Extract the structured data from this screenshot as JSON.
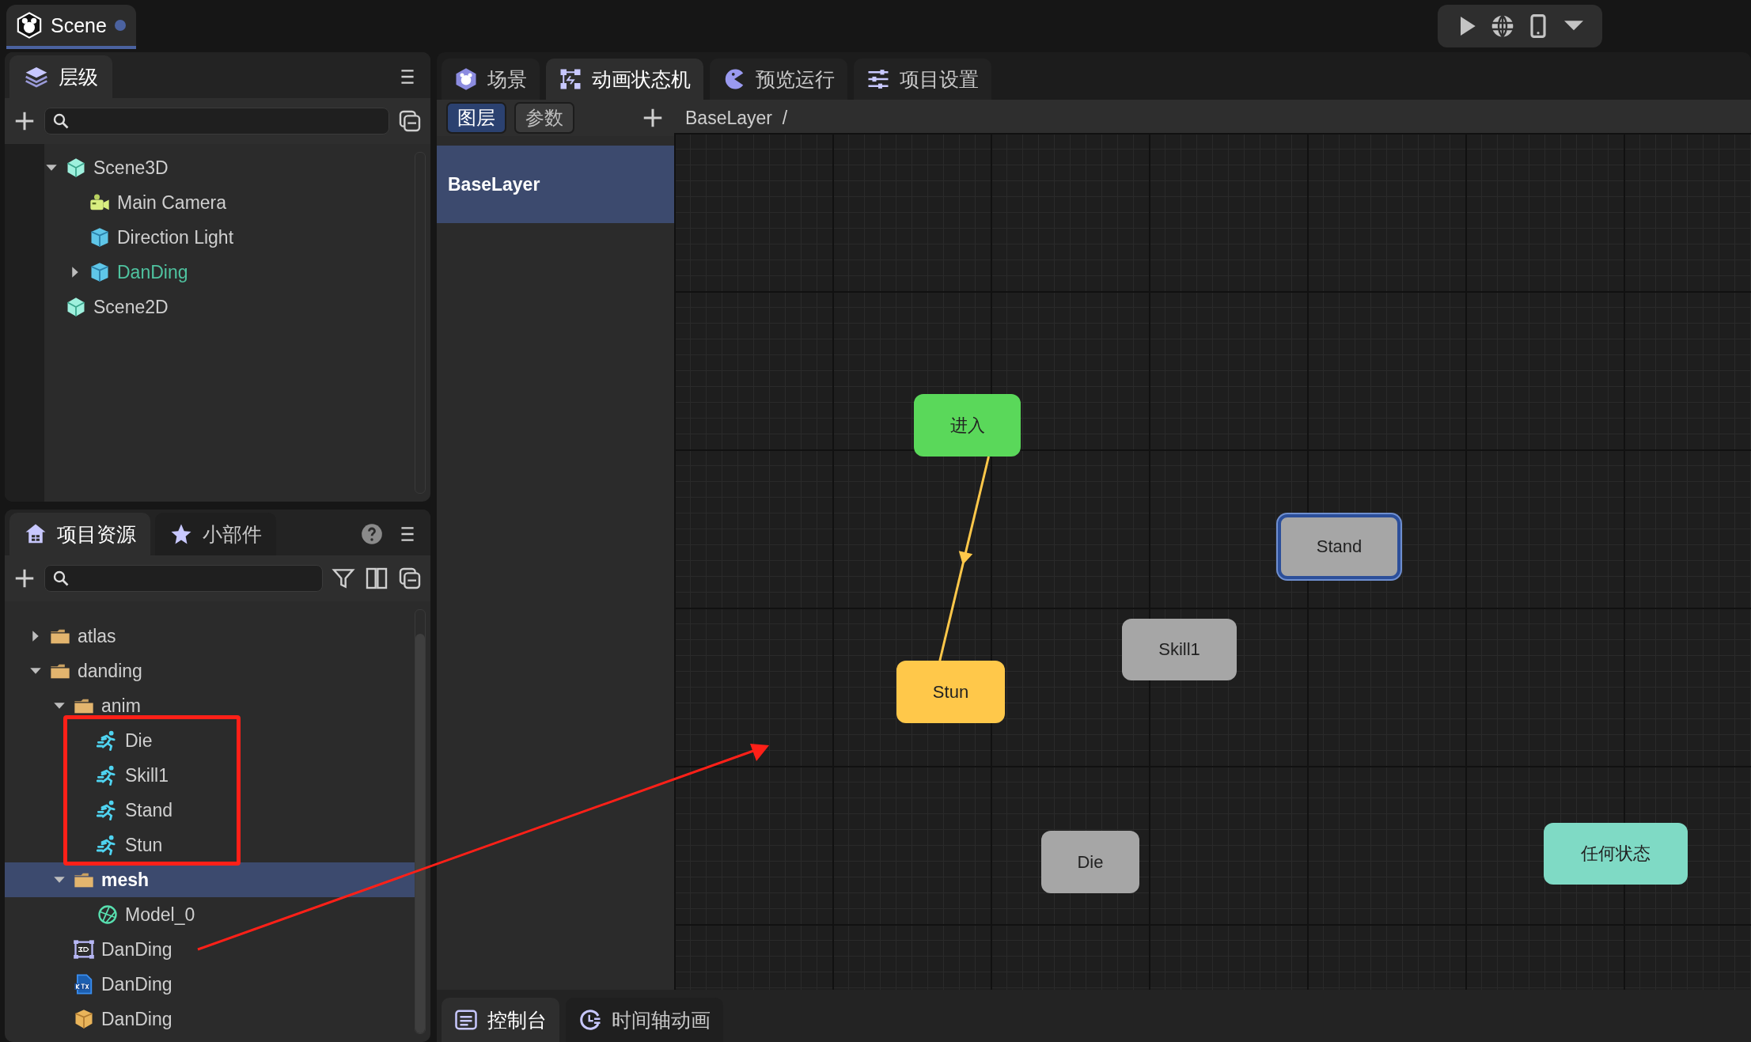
{
  "scene_tab": {
    "label": "Scene",
    "modified": true
  },
  "hierarchy": {
    "tab": "层级",
    "items": [
      {
        "label": "Scene3D",
        "kind": "scene",
        "expanded": true,
        "children": [
          {
            "label": "Main Camera",
            "kind": "camera"
          },
          {
            "label": "Direction Light",
            "kind": "cube"
          },
          {
            "label": "DanDing",
            "kind": "prefab",
            "expanded": false
          }
        ]
      },
      {
        "label": "Scene2D",
        "kind": "scene"
      }
    ]
  },
  "assets": {
    "tabs": [
      {
        "label": "项目资源",
        "selected": true
      },
      {
        "label": "小部件",
        "selected": false
      }
    ],
    "items": [
      {
        "label": "atlas",
        "kind": "folder",
        "expanded": false,
        "selected": false
      },
      {
        "label": "danding",
        "kind": "folder",
        "expanded": true,
        "selected": false,
        "children": [
          {
            "label": "anim",
            "kind": "folder",
            "expanded": true,
            "selected": false,
            "children": [
              {
                "label": "Die",
                "kind": "anim",
                "selected": false
              },
              {
                "label": "Skill1",
                "kind": "anim",
                "selected": false
              },
              {
                "label": "Stand",
                "kind": "anim",
                "selected": false
              },
              {
                "label": "Stun",
                "kind": "anim",
                "selected": false
              }
            ]
          },
          {
            "label": "mesh",
            "kind": "folder",
            "expanded": true,
            "selected": true,
            "children": [
              {
                "label": "Model_0",
                "kind": "model",
                "selected": false
              }
            ]
          },
          {
            "label": "DanDing",
            "kind": "scene3d",
            "selected": false
          },
          {
            "label": "DanDing",
            "kind": "ktx",
            "selected": false
          },
          {
            "label": "DanDing",
            "kind": "prefab",
            "selected": false
          }
        ]
      }
    ]
  },
  "editor_tabs": [
    {
      "label": "场景",
      "kind": "scene",
      "selected": false
    },
    {
      "label": "动画状态机",
      "kind": "graph",
      "selected": true
    },
    {
      "label": "预览运行",
      "kind": "preview",
      "selected": false
    },
    {
      "label": "项目设置",
      "kind": "settings",
      "selected": false
    }
  ],
  "sub_tabs": [
    {
      "label": "图层",
      "selected": true
    },
    {
      "label": "参数",
      "selected": false
    }
  ],
  "layers": [
    {
      "label": "BaseLayer",
      "selected": true
    }
  ],
  "breadcrumb": "BaseLayer  /",
  "states": [
    {
      "label": "进入",
      "kind": "entry",
      "selected": false
    },
    {
      "label": "Stand",
      "kind": "state",
      "selected": true
    },
    {
      "label": "Skill1",
      "kind": "state",
      "selected": false
    },
    {
      "label": "Stun",
      "kind": "default",
      "selected": false
    },
    {
      "label": "Die",
      "kind": "state",
      "selected": false
    },
    {
      "label": "任何状态",
      "kind": "any",
      "selected": false
    }
  ],
  "bottom_tabs": [
    {
      "label": "控制台",
      "kind": "console",
      "selected": true
    },
    {
      "label": "时间轴动画",
      "kind": "timeline",
      "selected": false
    }
  ]
}
